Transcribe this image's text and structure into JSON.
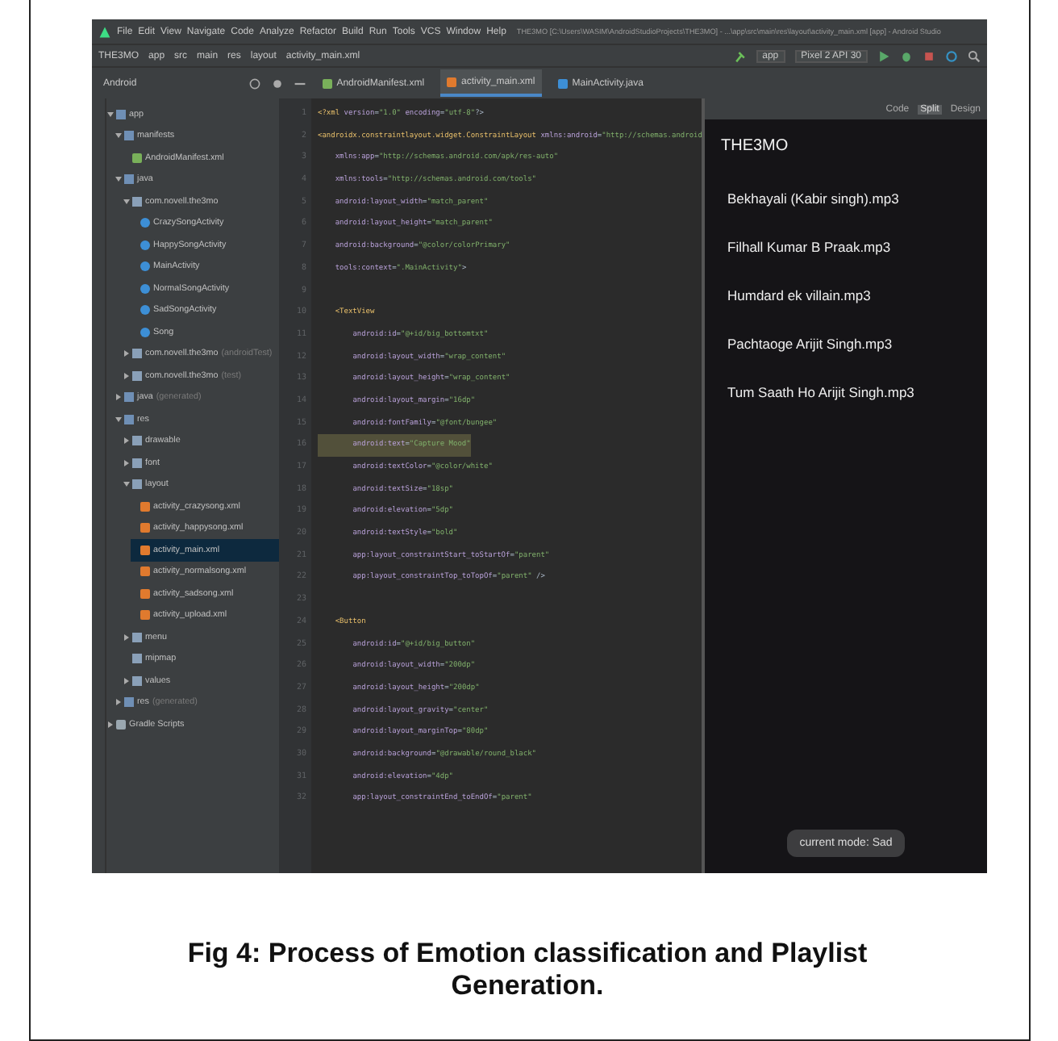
{
  "menu_bar": {
    "items": [
      "File",
      "Edit",
      "View",
      "Navigate",
      "Code",
      "Analyze",
      "Refactor",
      "Build",
      "Run",
      "Tools",
      "VCS",
      "Window",
      "Help"
    ],
    "title": "THE3MO [C:\\Users\\WASIM\\AndroidStudioProjects\\THE3MO] - ...\\app\\src\\main\\res\\layout\\activity_main.xml [app] - Android Studio"
  },
  "breadcrumbs": [
    "THE3MO",
    "app",
    "src",
    "main",
    "res",
    "layout",
    "activity_main.xml"
  ],
  "run_config": {
    "module": "app",
    "device": "Pixel 2 API 30"
  },
  "project_view": {
    "label": "Android"
  },
  "editor_tabs": [
    {
      "label": "AndroidManifest.xml",
      "kind": "manifest",
      "selected": false
    },
    {
      "label": "activity_main.xml",
      "kind": "xml",
      "selected": true
    },
    {
      "label": "MainActivity.java",
      "kind": "class",
      "selected": false
    }
  ],
  "view_modes": [
    {
      "label": "Code",
      "selected": false
    },
    {
      "label": "Split",
      "selected": true
    },
    {
      "label": "Design",
      "selected": false
    }
  ],
  "tree": [
    {
      "label": "app",
      "kind": "module",
      "expanded": true,
      "selected": false,
      "children": [
        {
          "label": "manifests",
          "kind": "folder",
          "expanded": true,
          "selected": false,
          "children": [
            {
              "label": "AndroidManifest.xml",
              "kind": "manifest",
              "selected": false
            }
          ]
        },
        {
          "label": "java",
          "kind": "folder",
          "expanded": true,
          "selected": false,
          "children": [
            {
              "label": "com.novell.the3mo",
              "kind": "package",
              "expanded": true,
              "selected": false,
              "children": [
                {
                  "label": "CrazySongActivity",
                  "kind": "class",
                  "selected": false
                },
                {
                  "label": "HappySongActivity",
                  "kind": "class",
                  "selected": false
                },
                {
                  "label": "MainActivity",
                  "kind": "class",
                  "selected": false
                },
                {
                  "label": "NormalSongActivity",
                  "kind": "class",
                  "selected": false
                },
                {
                  "label": "SadSongActivity",
                  "kind": "class",
                  "selected": false
                },
                {
                  "label": "Song",
                  "kind": "class",
                  "selected": false
                }
              ]
            },
            {
              "label": "com.novell.the3mo",
              "note": "(androidTest)",
              "kind": "package",
              "expanded": false,
              "selected": false
            },
            {
              "label": "com.novell.the3mo",
              "note": "(test)",
              "kind": "package",
              "expanded": false,
              "selected": false
            }
          ]
        },
        {
          "label": "java",
          "note": "(generated)",
          "kind": "folder",
          "expanded": false,
          "selected": false
        },
        {
          "label": "res",
          "kind": "folder",
          "expanded": true,
          "selected": false,
          "children": [
            {
              "label": "drawable",
              "kind": "package",
              "expanded": false,
              "selected": false
            },
            {
              "label": "font",
              "kind": "package",
              "expanded": false,
              "selected": false
            },
            {
              "label": "layout",
              "kind": "package",
              "expanded": true,
              "selected": false,
              "children": [
                {
                  "label": "activity_crazysong.xml",
                  "kind": "xml",
                  "selected": false
                },
                {
                  "label": "activity_happysong.xml",
                  "kind": "xml",
                  "selected": false
                },
                {
                  "label": "activity_main.xml",
                  "kind": "xml",
                  "selected": true
                },
                {
                  "label": "activity_normalsong.xml",
                  "kind": "xml",
                  "selected": false
                },
                {
                  "label": "activity_sadsong.xml",
                  "kind": "xml",
                  "selected": false
                },
                {
                  "label": "activity_upload.xml",
                  "kind": "xml",
                  "selected": false
                }
              ]
            },
            {
              "label": "menu",
              "kind": "package",
              "expanded": false,
              "selected": false
            },
            {
              "label": "mipmap",
              "kind": "package",
              "selected": false
            },
            {
              "label": "values",
              "kind": "package",
              "expanded": false,
              "selected": false
            }
          ]
        },
        {
          "label": "res",
          "note": "(generated)",
          "kind": "folder",
          "expanded": false,
          "selected": false
        }
      ]
    },
    {
      "label": "Gradle Scripts",
      "kind": "gradle",
      "expanded": false,
      "selected": false
    }
  ],
  "code_lines": [
    {
      "number": "1",
      "text": "<?xml version=\"1.0\" encoding=\"utf-8\"?>",
      "highlighted": false
    },
    {
      "number": "2",
      "text": "<androidx.constraintlayout.widget.ConstraintLayout xmlns:android=\"http://schemas.android",
      "highlighted": false
    },
    {
      "number": "3",
      "text": "    xmlns:app=\"http://schemas.android.com/apk/res-auto\"",
      "highlighted": false
    },
    {
      "number": "4",
      "text": "    xmlns:tools=\"http://schemas.android.com/tools\"",
      "highlighted": false
    },
    {
      "number": "5",
      "text": "    android:layout_width=\"match_parent\"",
      "highlighted": false
    },
    {
      "number": "6",
      "text": "    android:layout_height=\"match_parent\"",
      "highlighted": false
    },
    {
      "number": "7",
      "text": "    android:background=\"@color/colorPrimary\"",
      "highlighted": false
    },
    {
      "number": "8",
      "text": "    tools:context=\".MainActivity\">",
      "highlighted": false
    },
    {
      "number": "9"
    },
    {
      "number": "10",
      "text": "    <TextView",
      "highlighted": false
    },
    {
      "number": "11",
      "text": "        android:id=\"@+id/big_bottomtxt\"",
      "highlighted": false
    },
    {
      "number": "12",
      "text": "        android:layout_width=\"wrap_content\"",
      "highlighted": false
    },
    {
      "number": "13",
      "text": "        android:layout_height=\"wrap_content\"",
      "highlighted": false
    },
    {
      "number": "14",
      "text": "        android:layout_margin=\"16dp\"",
      "highlighted": false
    },
    {
      "number": "15",
      "text": "        android:fontFamily=\"@font/bungee\"",
      "highlighted": false
    },
    {
      "number": "16",
      "text": "        android:text=\"Capture Mood\"",
      "highlighted": true
    },
    {
      "number": "17",
      "text": "        android:textColor=\"@color/white\"",
      "highlighted": false
    },
    {
      "number": "18",
      "text": "        android:textSize=\"18sp\"",
      "highlighted": false
    },
    {
      "number": "19",
      "text": "        android:elevation=\"5dp\"",
      "highlighted": false
    },
    {
      "number": "20",
      "text": "        android:textStyle=\"bold\"",
      "highlighted": false
    },
    {
      "number": "21",
      "text": "        app:layout_constraintStart_toStartOf=\"parent\"",
      "highlighted": false
    },
    {
      "number": "22",
      "text": "        app:layout_constraintTop_toTopOf=\"parent\" />",
      "highlighted": false
    },
    {
      "number": "23"
    },
    {
      "number": "24",
      "text": "    <Button",
      "highlighted": false
    },
    {
      "number": "25",
      "text": "        android:id=\"@+id/big_button\"",
      "highlighted": false
    },
    {
      "number": "26",
      "text": "        android:layout_width=\"200dp\"",
      "highlighted": false
    },
    {
      "number": "27",
      "text": "        android:layout_height=\"200dp\"",
      "highlighted": false
    },
    {
      "number": "28",
      "text": "        android:layout_gravity=\"center\"",
      "highlighted": false
    },
    {
      "number": "29",
      "text": "        android:layout_marginTop=\"80dp\"",
      "highlighted": false
    },
    {
      "number": "30",
      "text": "        android:background=\"@drawable/round_black\"",
      "highlighted": false
    },
    {
      "number": "31",
      "text": "        android:elevation=\"4dp\"",
      "highlighted": false
    },
    {
      "number": "32",
      "text": "        app:layout_constraintEnd_toEndOf=\"parent\"",
      "highlighted": false
    }
  ],
  "preview": {
    "app_title": "THE3MO",
    "songs": [
      "Bekhayali (Kabir singh).mp3",
      "Filhall Kumar B Praak.mp3",
      "Humdard ek villain.mp3",
      "Pachtaoge Arijit Singh.mp3",
      "Tum Saath Ho Arijit Singh.mp3"
    ],
    "toast": "current mode: Sad"
  },
  "caption": "Fig 4: Process of Emotion classification and Playlist Generation."
}
